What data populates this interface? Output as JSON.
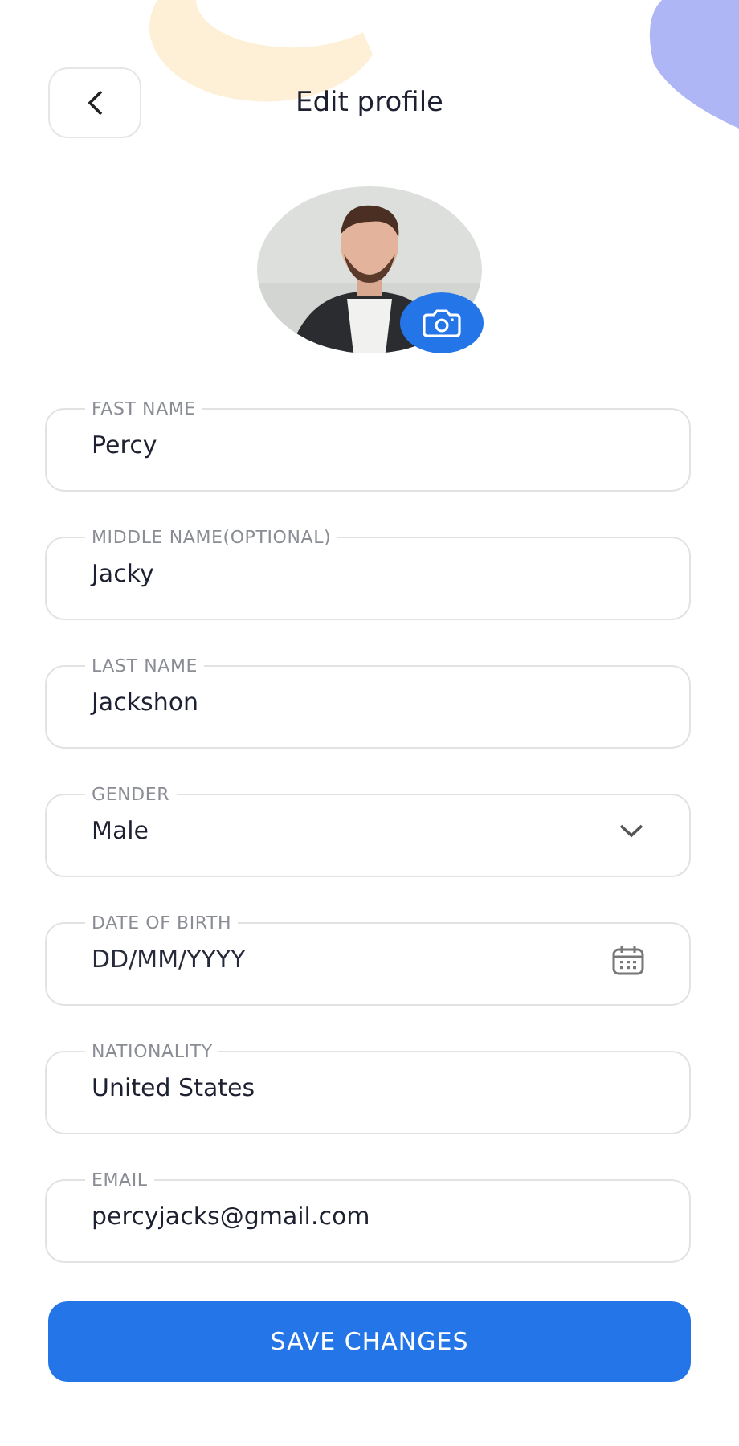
{
  "header": {
    "title": "Edit profile"
  },
  "fields": [
    {
      "kind": "text",
      "label": "FAST NAME",
      "value": "Percy"
    },
    {
      "kind": "text",
      "label": "MIDDLE NAME(OPTIONAL)",
      "value": "Jacky"
    },
    {
      "kind": "text",
      "label": "LAST NAME",
      "value": "Jackshon"
    },
    {
      "kind": "select",
      "label": "GENDER",
      "value": "Male"
    },
    {
      "kind": "date",
      "label": "DATE OF BIRTH",
      "placeholder": "DD/MM/YYYY"
    },
    {
      "kind": "text",
      "label": "NATIONALITY",
      "value": "United States"
    },
    {
      "kind": "text",
      "label": "EMAIL",
      "value": "percyjacks@gmail.com"
    }
  ],
  "save_button": "SAVE CHANGES"
}
